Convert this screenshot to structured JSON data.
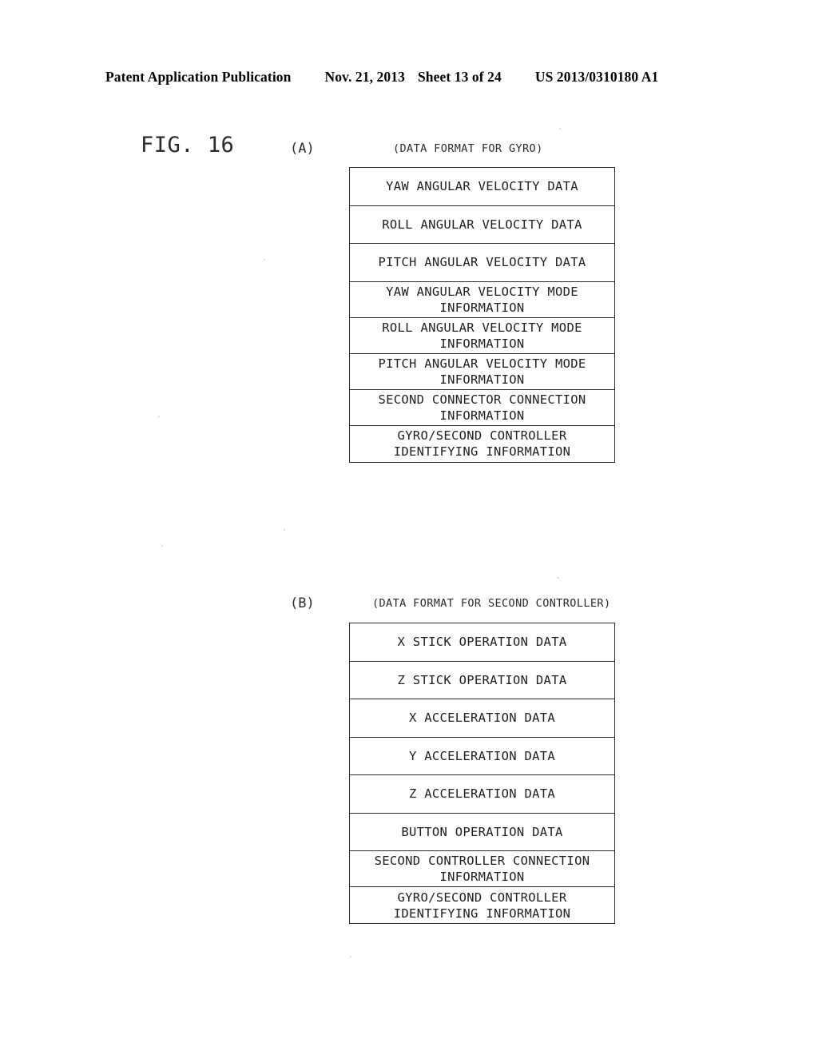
{
  "header": {
    "publication": "Patent Application Publication",
    "date": "Nov. 21, 2013",
    "sheet": "Sheet 13 of 24",
    "patent_number": "US 2013/0310180 A1"
  },
  "figure": {
    "label": "FIG. 16"
  },
  "sections": {
    "a": {
      "marker": "(A)",
      "caption": "(DATA FORMAT FOR GYRO)",
      "rows": [
        {
          "lines": [
            "YAW ANGULAR VELOCITY DATA"
          ]
        },
        {
          "lines": [
            "ROLL ANGULAR VELOCITY DATA"
          ]
        },
        {
          "lines": [
            "PITCH ANGULAR VELOCITY DATA"
          ]
        },
        {
          "lines": [
            "YAW ANGULAR VELOCITY MODE",
            "INFORMATION"
          ]
        },
        {
          "lines": [
            "ROLL ANGULAR VELOCITY MODE",
            "INFORMATION"
          ]
        },
        {
          "lines": [
            "PITCH ANGULAR VELOCITY MODE",
            "INFORMATION"
          ]
        },
        {
          "lines": [
            "SECOND CONNECTOR CONNECTION",
            "INFORMATION"
          ]
        },
        {
          "lines": [
            "GYRO/SECOND CONTROLLER",
            "IDENTIFYING INFORMATION"
          ]
        }
      ]
    },
    "b": {
      "marker": "(B)",
      "caption": "(DATA FORMAT FOR SECOND CONTROLLER)",
      "rows": [
        {
          "lines": [
            "X STICK OPERATION DATA"
          ]
        },
        {
          "lines": [
            "Z STICK OPERATION DATA"
          ]
        },
        {
          "lines": [
            "X ACCELERATION DATA"
          ]
        },
        {
          "lines": [
            "Y ACCELERATION DATA"
          ]
        },
        {
          "lines": [
            "Z ACCELERATION DATA"
          ]
        },
        {
          "lines": [
            "BUTTON OPERATION DATA"
          ]
        },
        {
          "lines": [
            "SECOND CONTROLLER CONNECTION",
            "INFORMATION"
          ]
        },
        {
          "lines": [
            "GYRO/SECOND CONTROLLER",
            "IDENTIFYING INFORMATION"
          ]
        }
      ]
    }
  },
  "colors": {
    "ink": "#1f1f1f",
    "rule": "#2a2a2a",
    "paper": "#ffffff"
  }
}
